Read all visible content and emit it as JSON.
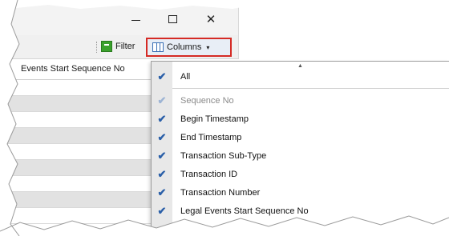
{
  "window": {
    "minimize_icon": "minimize-icon",
    "maximize_icon": "maximize-icon",
    "close_icon": "close-icon",
    "close_glyph": "✕"
  },
  "toolbar": {
    "filter_label": "Filter",
    "columns_label": "Columns",
    "columns_caret": "▾",
    "highlight_color": "#d52a24"
  },
  "grid": {
    "visible_header": "Events Start Sequence No"
  },
  "column_chooser": {
    "items": [
      {
        "label": "All",
        "checked": true,
        "disabled": false
      },
      {
        "label": "Sequence No",
        "checked": true,
        "disabled": true
      },
      {
        "label": "Begin Timestamp",
        "checked": true,
        "disabled": false
      },
      {
        "label": "End Timestamp",
        "checked": true,
        "disabled": false
      },
      {
        "label": "Transaction Sub-Type",
        "checked": true,
        "disabled": false
      },
      {
        "label": "Transaction ID",
        "checked": true,
        "disabled": false
      },
      {
        "label": "Transaction Number",
        "checked": true,
        "disabled": false
      },
      {
        "label": "Legal Events Start Sequence No",
        "checked": true,
        "disabled": false
      }
    ],
    "check_glyph": "✔",
    "scroll_up_glyph": "▲"
  }
}
